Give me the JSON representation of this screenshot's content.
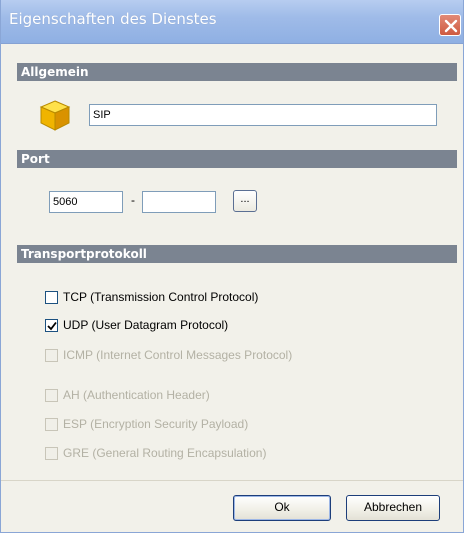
{
  "window": {
    "title": "Eigenschaften des Dienstes"
  },
  "icons": {
    "close": "close-icon",
    "service": "cube-icon",
    "checkmark": "checkmark-icon"
  },
  "sections": {
    "general": {
      "header": "Allgemein",
      "name_value": "SIP"
    },
    "port": {
      "header": "Port",
      "from_value": "5060",
      "to_value": "",
      "separator": "-",
      "browse_label": "..."
    },
    "transport": {
      "header": "Transportprotokoll",
      "options": [
        {
          "label": "TCP (Transmission Control Protocol)",
          "checked": false,
          "enabled": true
        },
        {
          "label": "UDP (User Datagram Protocol)",
          "checked": true,
          "enabled": true
        },
        {
          "label": "ICMP (Internet Control Messages Protocol)",
          "checked": false,
          "enabled": false
        },
        {
          "label": "AH (Authentication Header)",
          "checked": false,
          "enabled": false
        },
        {
          "label": "ESP (Encryption Security Payload)",
          "checked": false,
          "enabled": false
        },
        {
          "label": "GRE (General Routing Encapsulation)",
          "checked": false,
          "enabled": false
        }
      ]
    }
  },
  "buttons": {
    "ok_label": "Ok",
    "cancel_label": "Abbrechen"
  },
  "colors": {
    "titlebar": "#9fbbe8",
    "section_header": "#7b8491",
    "dialog_bg": "#f2f1ea",
    "close_button": "#cf5a40",
    "disabled_text": "#b3b1a4"
  }
}
